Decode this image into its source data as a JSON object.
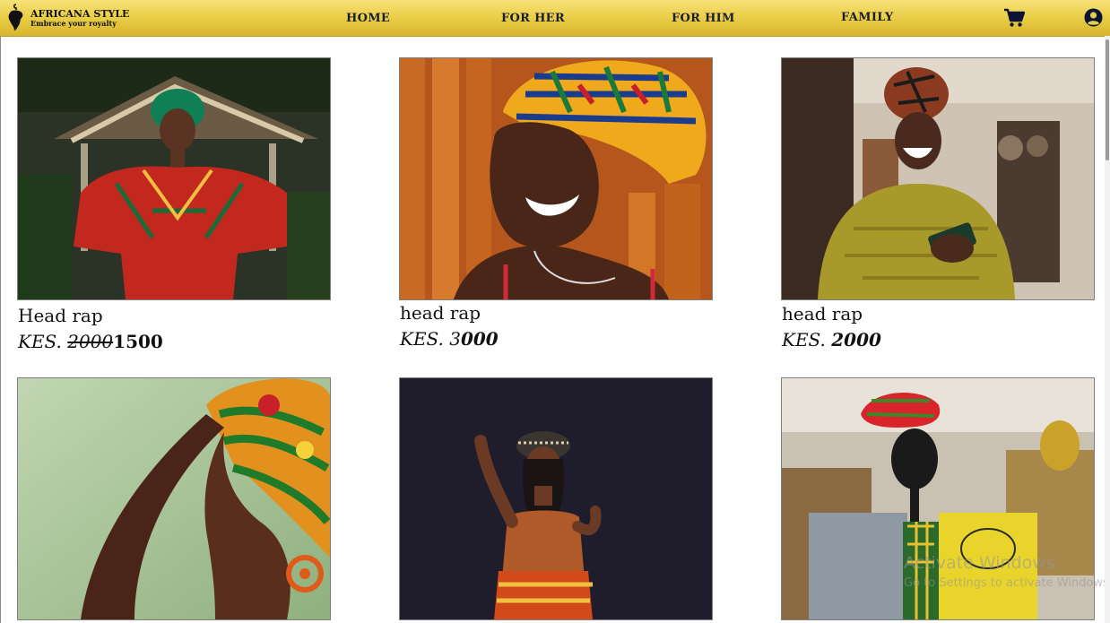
{
  "brand": {
    "name": "AFRICANA STYLE",
    "tagline": "Embrace your royalty"
  },
  "nav": {
    "home": "HOME",
    "for_her": "FOR HER",
    "for_him": "FOR HIM",
    "family": "FAMILY"
  },
  "icons": {
    "logo": "africa-hanger-icon",
    "cart": "cart-icon",
    "account": "user-circle-icon"
  },
  "colors": {
    "navbar": "#e8cd4a",
    "text": "#1d1d2e"
  },
  "products": [
    {
      "title": "Head rap",
      "currency": "KES.",
      "old_price": "2000",
      "price": "1500",
      "photo": "woman in green head wrap and red dashiki, hands on hips"
    },
    {
      "title": "head rap",
      "currency": "KES. 3",
      "price": "000",
      "photo": "smiling woman in orange kente head wrap"
    },
    {
      "title": "head rap",
      "currency": "KES.",
      "price": "2000",
      "photo": "woman in patterned head wrap and mustard sweater holding phone"
    },
    {
      "photo": "woman in green and orange print head wrap, profile"
    },
    {
      "photo": "woman in beaded crown pointing up, dark background"
    },
    {
      "photo": "mannequin head with red head wrap and fabrics"
    }
  ],
  "watermark": {
    "line1": "Activate Windows",
    "line2": "Go to Settings to activate Windows."
  }
}
